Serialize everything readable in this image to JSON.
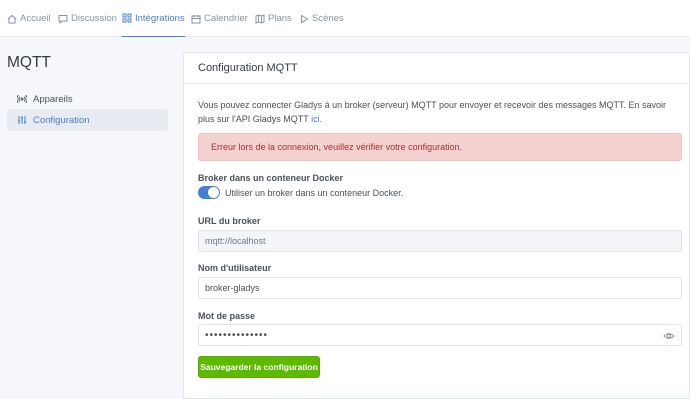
{
  "nav": {
    "items": [
      {
        "label": "Accueil",
        "icon": "home-icon"
      },
      {
        "label": "Discussion",
        "icon": "chat-icon"
      },
      {
        "label": "Intégrations",
        "icon": "grid-icon"
      },
      {
        "label": "Calendrier",
        "icon": "calendar-icon"
      },
      {
        "label": "Plans",
        "icon": "map-icon"
      },
      {
        "label": "Scènes",
        "icon": "play-icon"
      }
    ],
    "active_index": 2
  },
  "sidebar": {
    "title": "MQTT",
    "items": [
      {
        "label": "Appareils",
        "icon": "radio-icon"
      },
      {
        "label": "Configuration",
        "icon": "sliders-icon",
        "active": true
      }
    ]
  },
  "card": {
    "title": "Configuration MQTT",
    "intro": "Vous pouvez connecter Gladys à un broker (serveur) MQTT pour envoyer et recevoir des messages MQTT. En savoir plus sur l'API Gladys MQTT",
    "intro_link": "ici",
    "intro_end": ".",
    "error": "Erreur lors de la connexion, veuillez vérifier votre configuration.",
    "docker_label": "Broker dans un conteneur Docker",
    "docker_toggle_text": "Utiliser un broker dans un conteneur Docker.",
    "docker_toggle_on": true,
    "url_label": "URL du broker",
    "url_value": "mqtt://localhost",
    "user_label": "Nom d'utilisateur",
    "user_value": "broker-gladys",
    "password_label": "Mot de passe",
    "password_value": "••••••••••••••",
    "save_label": "Sauvegarder la configuration"
  },
  "colors": {
    "accent": "#467fcf",
    "success": "#5eba00",
    "error_bg": "#f5d2d2",
    "error_text": "#a42f2d"
  }
}
